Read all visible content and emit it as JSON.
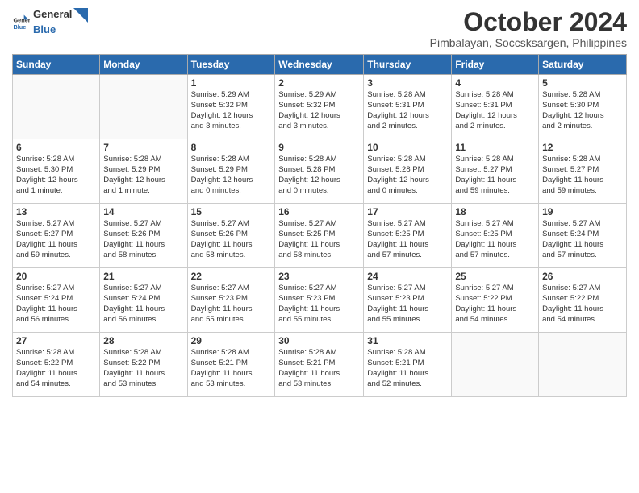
{
  "header": {
    "logo": {
      "general": "General",
      "blue": "Blue"
    },
    "month": "October 2024",
    "location": "Pimbalayan, Soccsksargen, Philippines"
  },
  "weekdays": [
    "Sunday",
    "Monday",
    "Tuesday",
    "Wednesday",
    "Thursday",
    "Friday",
    "Saturday"
  ],
  "weeks": [
    [
      {
        "day": "",
        "info": ""
      },
      {
        "day": "",
        "info": ""
      },
      {
        "day": "1",
        "info": "Sunrise: 5:29 AM\nSunset: 5:32 PM\nDaylight: 12 hours\nand 3 minutes."
      },
      {
        "day": "2",
        "info": "Sunrise: 5:29 AM\nSunset: 5:32 PM\nDaylight: 12 hours\nand 3 minutes."
      },
      {
        "day": "3",
        "info": "Sunrise: 5:28 AM\nSunset: 5:31 PM\nDaylight: 12 hours\nand 2 minutes."
      },
      {
        "day": "4",
        "info": "Sunrise: 5:28 AM\nSunset: 5:31 PM\nDaylight: 12 hours\nand 2 minutes."
      },
      {
        "day": "5",
        "info": "Sunrise: 5:28 AM\nSunset: 5:30 PM\nDaylight: 12 hours\nand 2 minutes."
      }
    ],
    [
      {
        "day": "6",
        "info": "Sunrise: 5:28 AM\nSunset: 5:30 PM\nDaylight: 12 hours\nand 1 minute."
      },
      {
        "day": "7",
        "info": "Sunrise: 5:28 AM\nSunset: 5:29 PM\nDaylight: 12 hours\nand 1 minute."
      },
      {
        "day": "8",
        "info": "Sunrise: 5:28 AM\nSunset: 5:29 PM\nDaylight: 12 hours\nand 0 minutes."
      },
      {
        "day": "9",
        "info": "Sunrise: 5:28 AM\nSunset: 5:28 PM\nDaylight: 12 hours\nand 0 minutes."
      },
      {
        "day": "10",
        "info": "Sunrise: 5:28 AM\nSunset: 5:28 PM\nDaylight: 12 hours\nand 0 minutes."
      },
      {
        "day": "11",
        "info": "Sunrise: 5:28 AM\nSunset: 5:27 PM\nDaylight: 11 hours\nand 59 minutes."
      },
      {
        "day": "12",
        "info": "Sunrise: 5:28 AM\nSunset: 5:27 PM\nDaylight: 11 hours\nand 59 minutes."
      }
    ],
    [
      {
        "day": "13",
        "info": "Sunrise: 5:27 AM\nSunset: 5:27 PM\nDaylight: 11 hours\nand 59 minutes."
      },
      {
        "day": "14",
        "info": "Sunrise: 5:27 AM\nSunset: 5:26 PM\nDaylight: 11 hours\nand 58 minutes."
      },
      {
        "day": "15",
        "info": "Sunrise: 5:27 AM\nSunset: 5:26 PM\nDaylight: 11 hours\nand 58 minutes."
      },
      {
        "day": "16",
        "info": "Sunrise: 5:27 AM\nSunset: 5:25 PM\nDaylight: 11 hours\nand 58 minutes."
      },
      {
        "day": "17",
        "info": "Sunrise: 5:27 AM\nSunset: 5:25 PM\nDaylight: 11 hours\nand 57 minutes."
      },
      {
        "day": "18",
        "info": "Sunrise: 5:27 AM\nSunset: 5:25 PM\nDaylight: 11 hours\nand 57 minutes."
      },
      {
        "day": "19",
        "info": "Sunrise: 5:27 AM\nSunset: 5:24 PM\nDaylight: 11 hours\nand 57 minutes."
      }
    ],
    [
      {
        "day": "20",
        "info": "Sunrise: 5:27 AM\nSunset: 5:24 PM\nDaylight: 11 hours\nand 56 minutes."
      },
      {
        "day": "21",
        "info": "Sunrise: 5:27 AM\nSunset: 5:24 PM\nDaylight: 11 hours\nand 56 minutes."
      },
      {
        "day": "22",
        "info": "Sunrise: 5:27 AM\nSunset: 5:23 PM\nDaylight: 11 hours\nand 55 minutes."
      },
      {
        "day": "23",
        "info": "Sunrise: 5:27 AM\nSunset: 5:23 PM\nDaylight: 11 hours\nand 55 minutes."
      },
      {
        "day": "24",
        "info": "Sunrise: 5:27 AM\nSunset: 5:23 PM\nDaylight: 11 hours\nand 55 minutes."
      },
      {
        "day": "25",
        "info": "Sunrise: 5:27 AM\nSunset: 5:22 PM\nDaylight: 11 hours\nand 54 minutes."
      },
      {
        "day": "26",
        "info": "Sunrise: 5:27 AM\nSunset: 5:22 PM\nDaylight: 11 hours\nand 54 minutes."
      }
    ],
    [
      {
        "day": "27",
        "info": "Sunrise: 5:28 AM\nSunset: 5:22 PM\nDaylight: 11 hours\nand 54 minutes."
      },
      {
        "day": "28",
        "info": "Sunrise: 5:28 AM\nSunset: 5:22 PM\nDaylight: 11 hours\nand 53 minutes."
      },
      {
        "day": "29",
        "info": "Sunrise: 5:28 AM\nSunset: 5:21 PM\nDaylight: 11 hours\nand 53 minutes."
      },
      {
        "day": "30",
        "info": "Sunrise: 5:28 AM\nSunset: 5:21 PM\nDaylight: 11 hours\nand 53 minutes."
      },
      {
        "day": "31",
        "info": "Sunrise: 5:28 AM\nSunset: 5:21 PM\nDaylight: 11 hours\nand 52 minutes."
      },
      {
        "day": "",
        "info": ""
      },
      {
        "day": "",
        "info": ""
      }
    ]
  ]
}
